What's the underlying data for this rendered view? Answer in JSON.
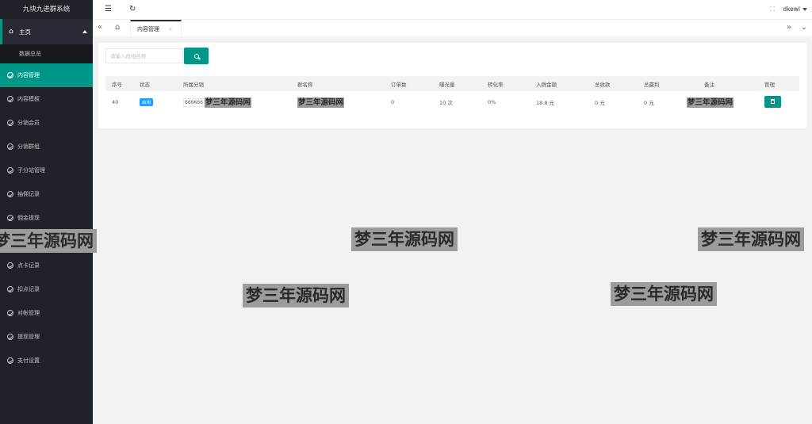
{
  "app": {
    "title": "九块九进群系统"
  },
  "sidebar": {
    "home_label": "主页",
    "home_sub": "数据总览",
    "items": [
      {
        "label": "内容管理",
        "active": true
      },
      {
        "label": "内容模板"
      },
      {
        "label": "分销会员"
      },
      {
        "label": "分销群组"
      },
      {
        "label": "子分站管理"
      },
      {
        "label": "抽佣记录"
      },
      {
        "label": "佣金提现"
      },
      {
        "label": ""
      },
      {
        "label": "点卡记录"
      },
      {
        "label": "扣点记录"
      },
      {
        "label": "对帐管理"
      },
      {
        "label": "提现管理"
      },
      {
        "label": "支付设置"
      }
    ]
  },
  "header": {
    "username": "dkewl"
  },
  "tabs": [
    {
      "label": "内容管理",
      "close": "×"
    }
  ],
  "search": {
    "placeholder": "请输入群组名称"
  },
  "table": {
    "columns": [
      "序号",
      "状态",
      "所属分销",
      "群名称",
      "订单数",
      "曝光量",
      "转化率",
      "入群金额",
      "总收款",
      "总赢利",
      "备注",
      "管理"
    ],
    "rows": [
      {
        "id": "40",
        "status": "启用",
        "distributor_prefix": "666666",
        "distributor": "梦三年源码网",
        "group_name": "梦三年源码网",
        "orders": "0",
        "exposure": "10 次",
        "conversion": "0%",
        "join_amount": "18.8 元",
        "total_received": "0 元",
        "total_profit": "0 元",
        "remark": "梦三年源码网"
      }
    ]
  },
  "watermarks": [
    "梦三年源码网",
    "梦三年源码网",
    "梦三年源码网",
    "梦三年源码网",
    "梦三年源码网"
  ]
}
